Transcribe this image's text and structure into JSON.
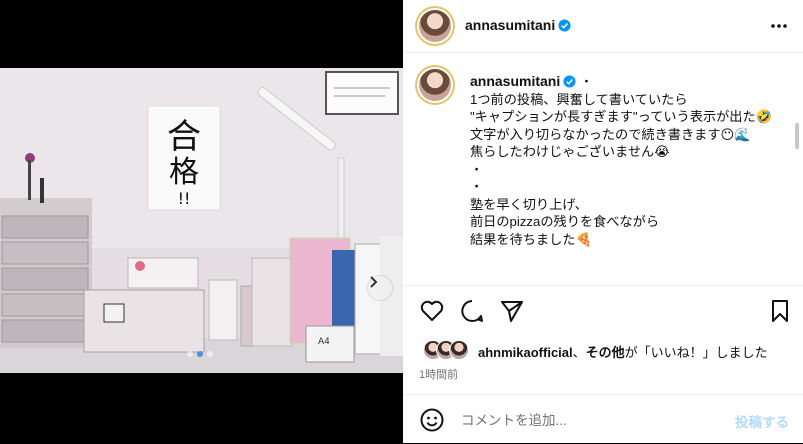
{
  "post": {
    "username": "annasumitani",
    "more_icon": "more-horizontal-icon",
    "verified_icon": "verified-badge-icon"
  },
  "photo": {
    "sign_text": "合格!!",
    "box_label": "A4"
  },
  "caption": {
    "username": "annasumitani",
    "separator": " ・",
    "text": "1つ前の投稿、興奮して書いていたら\n\"キャプションが長すぎます\"っていう表示が出た🤣\n文字が入り切らなかったので続き書きます😶🌊\n焦らしたわけじゃございません😭\n・\n・\n塾を早く切り上げ、\n前日のpizzaの残りを食べながら\n結果を待ちました🍕"
  },
  "actions": {
    "like_icon": "heart-icon",
    "comment_icon": "comment-icon",
    "share_icon": "share-icon",
    "save_icon": "bookmark-icon"
  },
  "likes": {
    "user": "ahnmikaofficial",
    "middle": "、",
    "others": "その他",
    "suffix": "が「いいね！」しました"
  },
  "time": "1時間前",
  "comment": {
    "emoji_icon": "smiley-icon",
    "placeholder": "コメントを追加...",
    "post_label": "投稿する"
  },
  "colors": {
    "verified": "#0095f6",
    "post_button": "#b3dbff",
    "muted": "#737373"
  }
}
